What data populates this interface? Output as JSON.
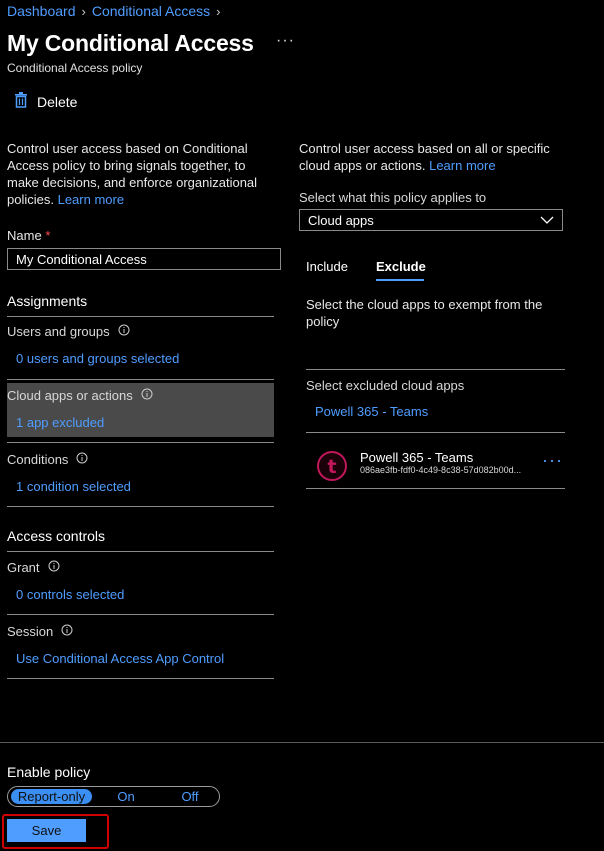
{
  "breadcrumb": {
    "items": [
      "Dashboard",
      "Conditional Access"
    ]
  },
  "header": {
    "title": "My Conditional Access",
    "more": "···",
    "subtitle": "Conditional Access policy"
  },
  "toolbar": {
    "delete_label": "Delete"
  },
  "left": {
    "intro": "Control user access based on Conditional Access policy to bring signals together, to make decisions, and enforce organizational policies.",
    "learn_more": "Learn more",
    "name_label": "Name",
    "name_required": "*",
    "name_value": "My Conditional Access",
    "assignments_heading": "Assignments",
    "users_label": "Users and groups",
    "users_value": "0 users and groups selected",
    "cloud_label": "Cloud apps or actions",
    "cloud_value": "1 app excluded",
    "conditions_label": "Conditions",
    "conditions_value": "1 condition selected",
    "access_heading": "Access controls",
    "grant_label": "Grant",
    "grant_value": "0 controls selected",
    "session_label": "Session",
    "session_value": "Use Conditional Access App Control"
  },
  "right": {
    "intro": "Control user access based on all or specific cloud apps or actions.",
    "learn_more": "Learn more",
    "select_label": "Select what this policy applies to",
    "select_value": "Cloud apps",
    "tabs": [
      {
        "label": "Include",
        "active": false
      },
      {
        "label": "Exclude",
        "active": true
      }
    ],
    "exempt_text": "Select the cloud apps to exempt from the policy",
    "excluded_label": "Select excluded cloud apps",
    "excluded_link": "Powell 365 - Teams",
    "app": {
      "name": "Powell 365 - Teams",
      "id": "086ae3fb-fdf0-4c49-8c38-57d082b00d...",
      "more": "···",
      "logo_letter": "t"
    }
  },
  "footer": {
    "enable_label": "Enable policy",
    "options": [
      "Report-only",
      "On",
      "Off"
    ],
    "selected": "Report-only",
    "save_label": "Save"
  },
  "colors": {
    "link": "#4f9dff",
    "highlight": "#4a4a4a",
    "accent": "#3b8ff3",
    "logo": "#c0185b",
    "outline": "#d00000"
  }
}
